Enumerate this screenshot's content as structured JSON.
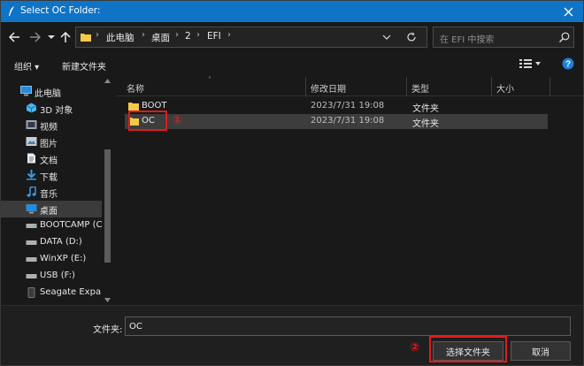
{
  "window": {
    "title": "Select OC Folder:",
    "accent": "#0f74c6"
  },
  "nav": {
    "back_icon": "arrow-left-icon",
    "forward_icon": "arrow-right-icon",
    "recent_icon": "chevron-down-icon",
    "up_icon": "arrow-up-icon",
    "breadcrumb": [
      "此电脑",
      "桌面",
      "2",
      "EFI"
    ],
    "search_placeholder": "在 EFI 中搜索"
  },
  "toolbar": {
    "organize_label": "组织 ▾",
    "new_folder_label": "新建文件夹"
  },
  "sidebar": {
    "items": [
      {
        "label": "此电脑",
        "icon": "pc-icon"
      },
      {
        "label": "3D 对象",
        "icon": "3d-objects-icon"
      },
      {
        "label": "视频",
        "icon": "video-icon"
      },
      {
        "label": "图片",
        "icon": "pictures-icon"
      },
      {
        "label": "文档",
        "icon": "documents-icon"
      },
      {
        "label": "下载",
        "icon": "download-icon"
      },
      {
        "label": "音乐",
        "icon": "music-icon"
      },
      {
        "label": "桌面",
        "icon": "desktop-icon"
      },
      {
        "label": "BOOTCAMP (C",
        "icon": "drive-icon"
      },
      {
        "label": "DATA (D:)",
        "icon": "drive-icon"
      },
      {
        "label": "WinXP  (E:)",
        "icon": "drive-icon"
      },
      {
        "label": "USB (F:)",
        "icon": "drive-icon"
      },
      {
        "label": "Seagate Expan",
        "icon": "external-drive-icon"
      }
    ]
  },
  "columns": {
    "name": "名称",
    "date": "修改日期",
    "type": "类型",
    "size": "大小"
  },
  "files": [
    {
      "name": "BOOT",
      "date": "2023/7/31 19:08",
      "type": "文件夹"
    },
    {
      "name": "OC",
      "date": "2023/7/31 19:08",
      "type": "文件夹"
    }
  ],
  "annotations": {
    "step1": "①",
    "step2": "②",
    "color": "#e11b1b"
  },
  "footer": {
    "folder_label": "文件夹:",
    "folder_value": "OC",
    "select_label": "选择文件夹",
    "cancel_label": "取消"
  }
}
